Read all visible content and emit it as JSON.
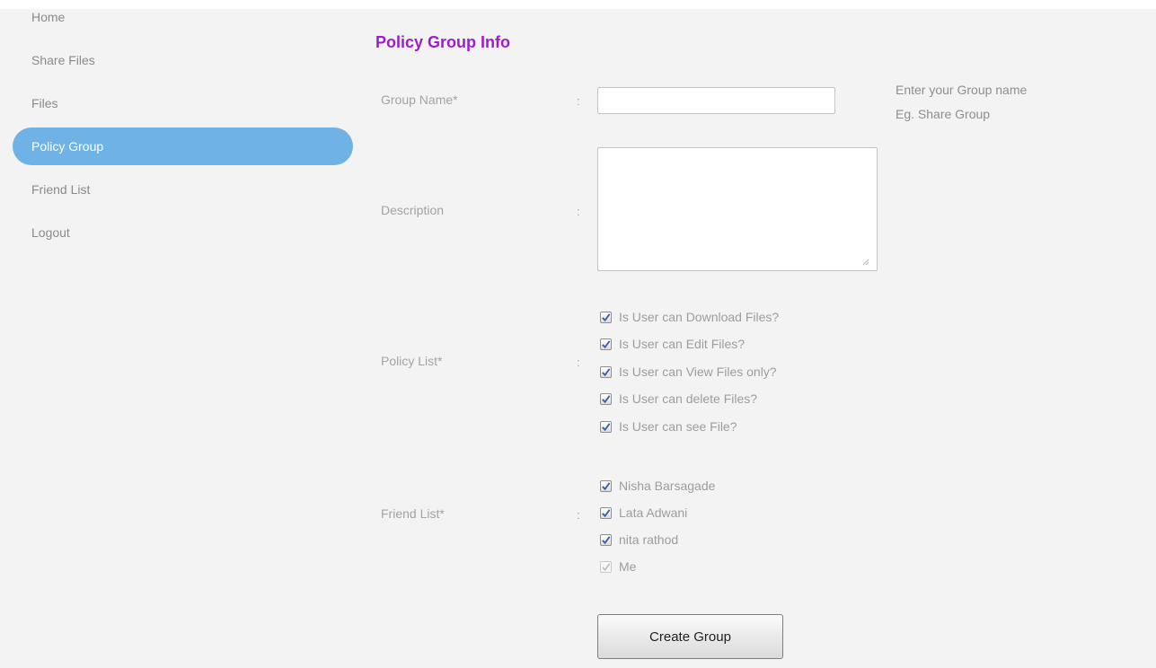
{
  "sidebar": {
    "items": [
      {
        "label": "Home"
      },
      {
        "label": "Share Files"
      },
      {
        "label": "Files"
      },
      {
        "label": "Policy Group"
      },
      {
        "label": "Friend List"
      },
      {
        "label": "Logout"
      }
    ]
  },
  "form": {
    "title": "Policy Group Info",
    "colon": ":",
    "group_name": {
      "label": "Group Name*",
      "value": "",
      "hint_line1": "Enter your Group name",
      "hint_line2": "Eg. Share Group"
    },
    "description": {
      "label": "Description",
      "value": ""
    },
    "policy_list": {
      "label": "Policy List*",
      "options": [
        {
          "label": "Is User can Download Files?",
          "checked": true
        },
        {
          "label": "Is User can Edit Files?",
          "checked": true
        },
        {
          "label": "Is User can View Files only?",
          "checked": true
        },
        {
          "label": "Is User can delete Files?",
          "checked": true
        },
        {
          "label": "Is User can see File?",
          "checked": true
        }
      ]
    },
    "friend_list": {
      "label": "Friend List*",
      "options": [
        {
          "label": "Nisha Barsagade",
          "checked": true
        },
        {
          "label": "Lata Adwani",
          "checked": true
        },
        {
          "label": "nita rathod",
          "checked": true
        },
        {
          "label": "Me",
          "checked": true,
          "disabled": true
        }
      ]
    },
    "submit_label": "Create Group"
  },
  "colors": {
    "accent_title": "#9a1fc9",
    "active_nav_bg": "#6fb3e6",
    "check_mark": "#3d5ea8"
  }
}
